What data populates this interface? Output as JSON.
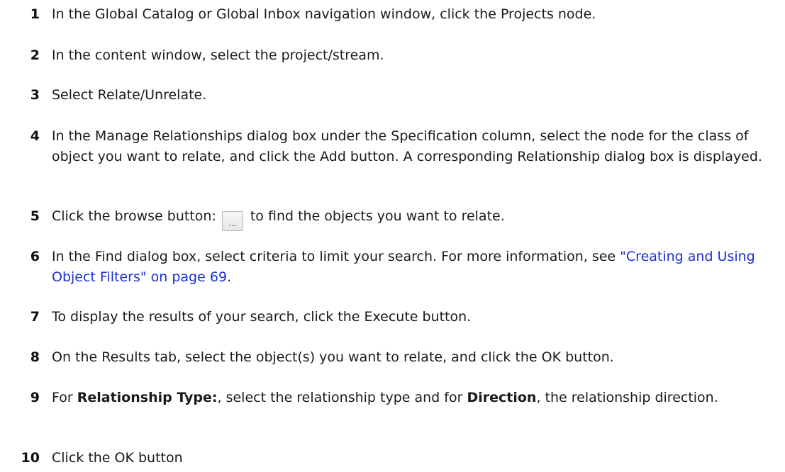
{
  "steps": [
    {
      "number": "1",
      "text": "In the Global Catalog or Global Inbox navigation window, click the Projects node."
    },
    {
      "number": "2",
      "text": "In the content window, select the project/stream."
    },
    {
      "number": "3",
      "text": "Select Relate/Unrelate."
    },
    {
      "number": "4",
      "text": "In the Manage Relationships dialog box under the Specification column, select the node for the class of object you want to relate, and click the Add button. A corresponding Relationship dialog box is displayed."
    },
    {
      "number": "5",
      "text_before": "Click the browse button:",
      "button_label": "...",
      "text_after": "to find the objects you want to relate."
    },
    {
      "number": "6",
      "text_before": "In the Find dialog box, select criteria to limit your search. For more information, see",
      "link_text": "\"Creating and Using Object Filters\" on page 69",
      "text_after": "."
    },
    {
      "number": "7",
      "text": "To display the results of your search, click the Execute button."
    },
    {
      "number": "8",
      "text": "On the Results tab, select the object(s) you want to relate, and click the OK button."
    },
    {
      "number": "9",
      "text_1": "For",
      "bold_1": "Relationship Type:",
      "text_2": ", select the relationship type and for",
      "bold_2": "Direction",
      "text_3": ", the relationship direction."
    },
    {
      "number": "10",
      "text": "Click the OK button"
    }
  ]
}
